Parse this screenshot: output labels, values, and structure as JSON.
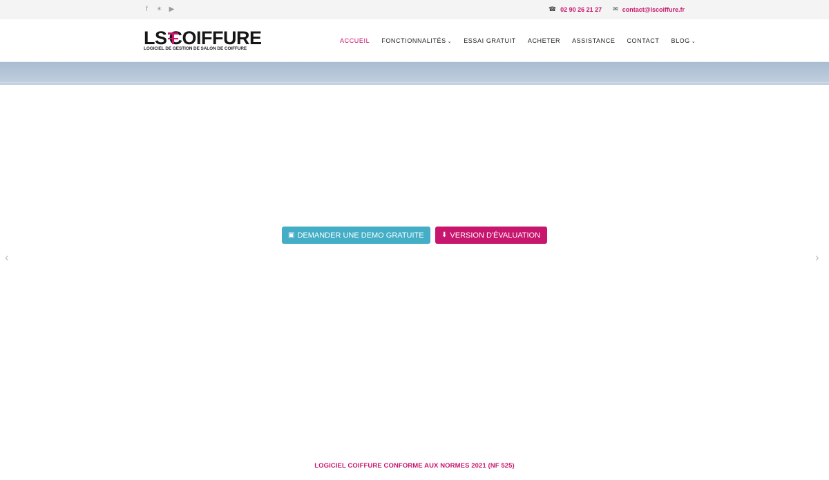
{
  "topbar": {
    "social": [
      {
        "name": "facebook-icon",
        "glyph": "f"
      },
      {
        "name": "twitter-icon",
        "glyph": "🐦"
      },
      {
        "name": "youtube-icon",
        "glyph": "▶"
      }
    ],
    "phone": "02 90 26 21 27",
    "email": "contact@lscoiffure.fr"
  },
  "brand": {
    "logo_left": "LS",
    "logo_right": "COIFFURE",
    "tagline": "LOGICIEL DE GESTION DE SALON DE COIFFURE"
  },
  "nav": {
    "items": [
      {
        "label": "ACCUEIL",
        "active": true
      },
      {
        "label": "FONCTIONNALITÉS",
        "dropdown": true
      },
      {
        "label": "ESSAI GRATUIT"
      },
      {
        "label": "ACHETER"
      },
      {
        "label": "ASSISTANCE"
      },
      {
        "label": "CONTACT"
      },
      {
        "label": "BLOG",
        "dropdown": true
      }
    ],
    "chevron": "⌄"
  },
  "hero": {
    "demo_button": "DEMANDER UNE DEMO GRATUITE",
    "eval_button": "VERSION D'ÉVALUATION",
    "prev_arrow": "‹",
    "next_arrow": "›"
  },
  "footer_title": "LOGICIEL COIFFURE CONFORME AUX NORMES 2021 (NF 525)",
  "colors": {
    "accent": "#c8156d",
    "demo": "#43aec6"
  }
}
